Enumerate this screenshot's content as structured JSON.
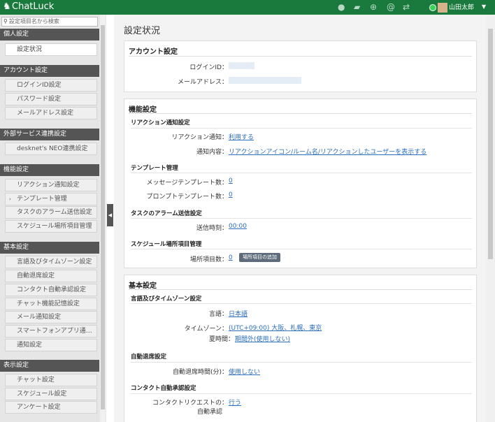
{
  "app": {
    "name": "ChatLuck",
    "user_name": "山田太郎"
  },
  "header_icons": [
    "person-icon",
    "chat-icon",
    "globe-icon",
    "at-icon",
    "transfer-icon"
  ],
  "sidebar": {
    "search_placeholder": "設定項目名から検索",
    "sections": [
      {
        "title": "個人設定",
        "items": [
          "設定状況"
        ]
      },
      {
        "title": "アカウント設定",
        "items": [
          "ログインID設定",
          "パスワード設定",
          "メールアドレス設定"
        ]
      },
      {
        "title": "外部サービス連携設定",
        "items": [
          "desknet's NEO連携設定"
        ]
      },
      {
        "title": "機能設定",
        "items": [
          "リアクション通知設定",
          "テンプレート管理",
          "タスクのアラーム送信設定",
          "スケジュール場所項目管理"
        ]
      },
      {
        "title": "基本設定",
        "items": [
          "言語及びタイムゾーン設定",
          "自動退席設定",
          "コンタクト自動承認設定",
          "チャット機能記憶設定",
          "メール通知設定",
          "スマートフォンアプリ通…",
          "通知設定"
        ]
      },
      {
        "title": "表示設定",
        "items": [
          "チャット設定",
          "スケジュール設定",
          "アンケート設定"
        ]
      }
    ]
  },
  "main": {
    "page_title": "設定状況",
    "account": {
      "title": "アカウント設定",
      "login_id_label": "ログインID：",
      "email_label": "メールアドレス："
    },
    "features": {
      "title": "機能設定",
      "reaction": {
        "title": "リアクション通知設定",
        "notify_label": "リアクション通知：",
        "notify_value": "利用する",
        "content_label": "通知内容：",
        "content_value": "リアクションアイコン/ルーム名/リアクションしたユーザーを表示する"
      },
      "template": {
        "title": "テンプレート管理",
        "message_label": "メッセージテンプレート数：",
        "message_value": "0",
        "prompt_label": "プロンプトテンプレート数：",
        "prompt_value": "0"
      },
      "alarm": {
        "title": "タスクのアラーム送信設定",
        "time_label": "送信時刻：",
        "time_value": "00:00"
      },
      "location": {
        "title": "スケジュール場所項目管理",
        "count_label": "場所項目数：",
        "count_value": "0",
        "add_button": "場所項目の追加"
      }
    },
    "basic": {
      "title": "基本設定",
      "lang": {
        "title": "言語及びタイムゾーン設定",
        "lang_label": "言語：",
        "lang_value": "日本語",
        "tz_label": "タイムゾーン：",
        "tz_value": "(UTC+09:00) 大阪、札幌、東京",
        "dst_label": "夏時間：",
        "dst_value": "期間外(使用しない)"
      },
      "away": {
        "title": "自動退席設定",
        "time_label": "自動退席時間(分)：",
        "time_value": "使用しない"
      },
      "contact": {
        "title": "コンタクト自動承認設定",
        "label_line1": "コンタクトリクエストの：",
        "label_line2": "自動承認",
        "value": "行う"
      }
    }
  }
}
